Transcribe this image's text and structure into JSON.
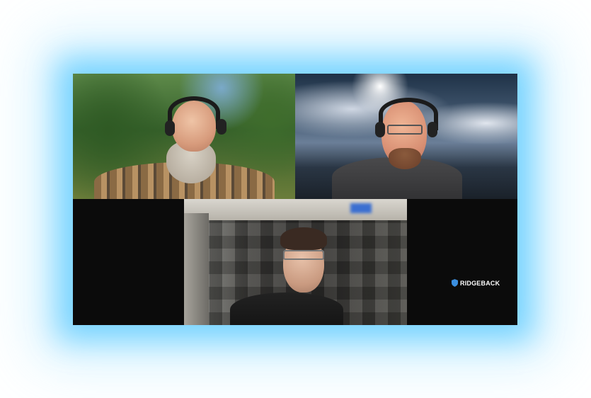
{
  "call": {
    "brand": {
      "logo_text": "RIDGEBACK",
      "logo_icon": "shield-icon",
      "logo_color": "#3b8fe0"
    },
    "participants": [
      {
        "position": "top-left",
        "background": "forest"
      },
      {
        "position": "top-right",
        "background": "clouds-mountains"
      },
      {
        "position": "bottom-center",
        "background": "acoustic-foam-room"
      }
    ],
    "glow_color": "#56c8ff"
  }
}
